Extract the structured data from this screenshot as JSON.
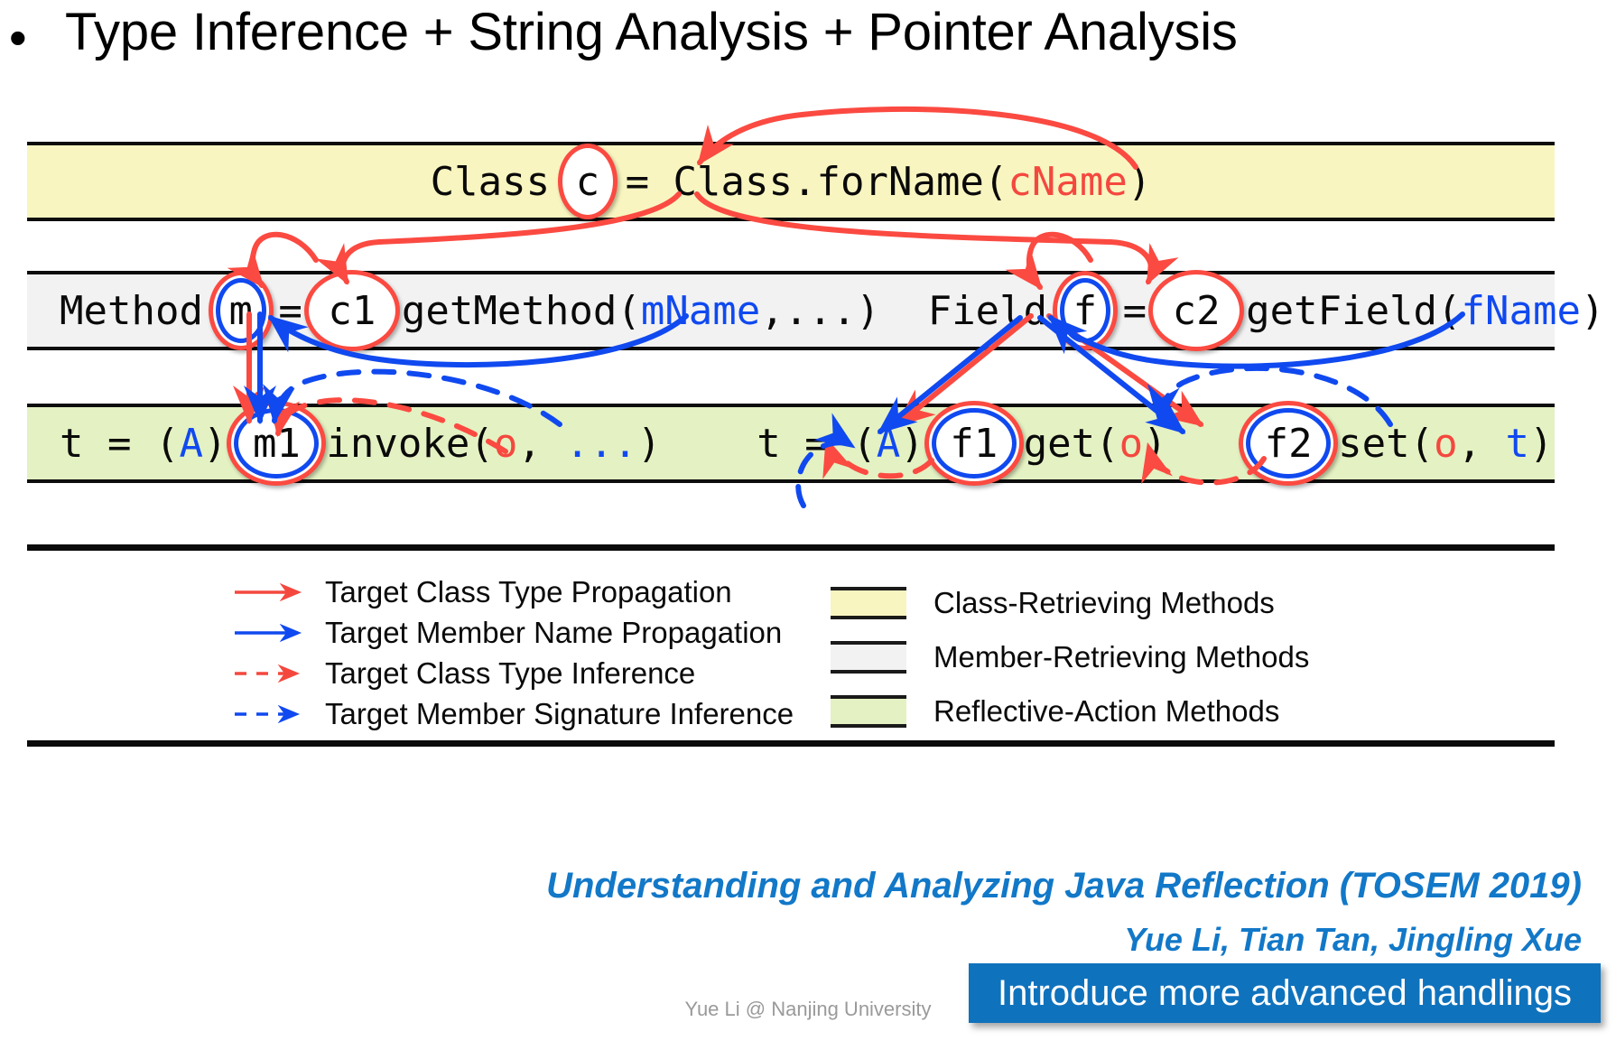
{
  "title": "Type Inference + String Analysis + Pointer Analysis",
  "bullet_glyph": "bullet-icon",
  "bands": {
    "class_retrieving": {
      "name": "Class-Retrieving Methods",
      "color": "#f9f5c0",
      "code": {
        "pre": "Class ",
        "var": "c",
        "mid": " = Class.forName(",
        "arg": "cName",
        "post": ")"
      }
    },
    "member_retrieving": {
      "name": "Member-Retrieving Methods",
      "color": "#f2f2f2",
      "method_stmt": {
        "pre": "Method ",
        "var": "m",
        "eq": " = ",
        "recv": "c1",
        "call": ".getMethod(",
        "arg": "mName",
        "post": ",...)"
      },
      "field_stmt": {
        "pre": "Field ",
        "var": "f",
        "eq": " = ",
        "recv": "c2",
        "call": ".getField(",
        "arg": "fName",
        "post": ")"
      }
    },
    "reflective_action": {
      "name": "Reflective-Action Methods",
      "color": "#e4f1c2",
      "invoke_stmt": {
        "pre": "t = (",
        "cast": "A",
        "pre2": ") ",
        "var": "m1",
        "call": ".invoke(",
        "arg1": "o",
        "sep": ", ",
        "arg2": "...",
        "post": ")"
      },
      "get_stmt": {
        "pre": "t = (",
        "cast": "A",
        "pre2": ") ",
        "var": "f1",
        "call": ".get(",
        "arg1": "o",
        "post": ")"
      },
      "set_stmt": {
        "var": "f2",
        "call": ".set(",
        "arg1": "o",
        "sep": ", ",
        "arg2": "t",
        "post": ")"
      }
    }
  },
  "legend": {
    "arrows": [
      {
        "label": "Target Class Type Propagation",
        "color": "#f4483f",
        "style": "solid"
      },
      {
        "label": "Target Member Name Propagation",
        "color": "#1049ef",
        "style": "solid"
      },
      {
        "label": "Target Class Type Inference",
        "color": "#f4483f",
        "style": "dashed"
      },
      {
        "label": "Target Member Signature Inference",
        "color": "#1049ef",
        "style": "dashed"
      }
    ],
    "swatches": [
      {
        "label": "Class-Retrieving Methods",
        "color": "#f9f5c0"
      },
      {
        "label": "Member-Retrieving Methods",
        "color": "#f2f2f2"
      },
      {
        "label": "Reflective-Action Methods",
        "color": "#e4f1c2"
      }
    ]
  },
  "citation": {
    "title": "Understanding and Analyzing Java Reflection (TOSEM 2019)",
    "authors": "Yue Li, Tian Tan, Jingling Xue",
    "color": "#1278c8"
  },
  "callout": {
    "text": "Introduce more advanced handlings",
    "background": "#0f72bd",
    "text_color": "#ffffff"
  },
  "footer": "Yue Li @ Nanjing University",
  "colors": {
    "red": "#f4483f",
    "blue": "#1049ef",
    "rule": "#0d0d0d"
  }
}
